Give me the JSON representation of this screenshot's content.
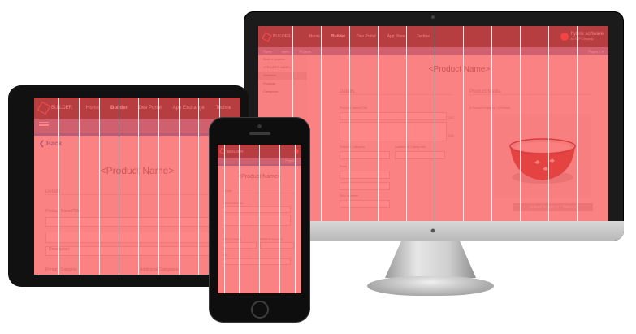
{
  "monitor": {
    "logo_text": "BUILDER",
    "nav": [
      "Home",
      "Builder",
      "Dev Portal",
      "App Store",
      "Techne"
    ],
    "active_nav": "Builder",
    "brand": {
      "name": "hybris software",
      "sub": "an SAP Company"
    },
    "subnav": [
      "Home",
      "Items",
      "Projects"
    ],
    "subnav_right": "Project 1 ▾",
    "sidebar": [
      "Back to projects",
      "<PROJECT NAME>",
      "Overview",
      "Products",
      "Categories"
    ],
    "sidebar_highlight": "Overview",
    "product_name": "<Product Name>",
    "details_heading": "Details",
    "media_heading": "Product Media",
    "product_name_label": "Product Name/Title",
    "primary_category_label": "Primary Category",
    "additional_categories_label": "Additional Categories",
    "price_label": "Price",
    "sku_label": "SKU Number",
    "images_label": "6 Product Images / 0 Videos",
    "upload_button": "Upload Image(s) / Video(s)",
    "counter_a": "120",
    "counter_b": "256"
  },
  "tablet": {
    "logo_text": "BUILDER",
    "nav": [
      "Home",
      "Builder",
      "Dev Portal",
      "App Exchange",
      "Techne"
    ],
    "active_nav": "Builder",
    "back_label": "Back",
    "product_name": "<Product Name>",
    "details_heading": "Details",
    "product_name_label": "Product Name/Title",
    "description_placeholder": "Description",
    "primary_category_label": "Primary Category",
    "additional_categories_label": "Additional Categories"
  },
  "phone": {
    "logo_text": "BUILDER",
    "subnav_right": "Project 1",
    "product_name": "<Product Name>",
    "details_heading": "Details",
    "product_name_label": "Product Name/Title",
    "primary_category_label": "Primary Category",
    "additional_categories_label": "Additional Categories",
    "price_label": "Price"
  },
  "icons": {
    "logo": "hexagon-icon",
    "brand": "hybris-logo-icon",
    "menu": "hamburger-icon",
    "back": "chevron-left-icon",
    "apple": "apple-logo-icon",
    "camera": "camera-icon",
    "home_button": "home-button-icon"
  },
  "colors": {
    "overlay": "#ff4848",
    "header": "#2d2d33",
    "subnav": "#7a8fb8",
    "accent_blue": "#2f84d6",
    "brand_red": "#e03838"
  }
}
